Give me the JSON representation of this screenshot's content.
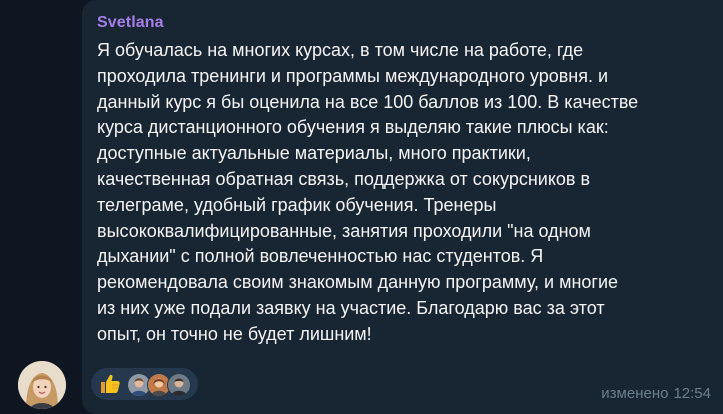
{
  "message": {
    "sender": "Svetlana",
    "text": "Я обучалась на многих курсах, в том числе на работе, где\nпроходила тренинги и программы международного уровня. и\nданный курс я бы оценила на все 100 баллов из 100. В качестве\nкурса дистанционного обучения я выделяю такие плюсы как:\nдоступные актуальные материалы, много практики,\nкачественная обратная связь, поддержка от сокурсников в\nтелеграме, удобный график обучения.  Тренеры\nвысококвалифицированные, занятия проходили \"на одном\nдыхании\" с полной вовлеченностью нас студентов. Я\nрекомендовала своим знакомым данную программу, и многие\nиз них уже подали заявку на участие. Благодарю вас за этот\nопыт, он точно не будет лишним!",
    "edited_label": "изменено",
    "time": "12:54"
  },
  "reactions": {
    "emoji": "thumbs-up-icon",
    "reactor_count": 3
  },
  "colors": {
    "background": "#0e1621",
    "bubble": "#182533",
    "sender": "#a67ee8",
    "text": "#f5f5f5",
    "meta": "#6d7f8f",
    "reaction_pill": "#25384d"
  }
}
